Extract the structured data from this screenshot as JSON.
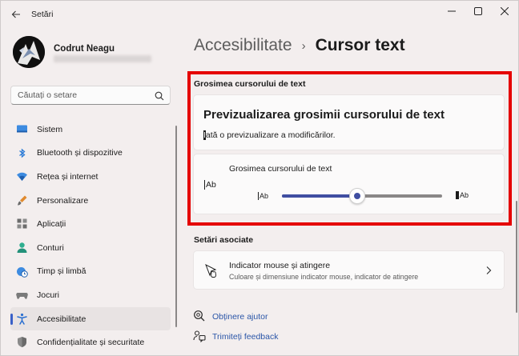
{
  "window": {
    "title": "Setări"
  },
  "user": {
    "name": "Codrut Neagu"
  },
  "search": {
    "placeholder": "Căutați o setare"
  },
  "nav": [
    {
      "label": "Sistem",
      "icon": "monitor-icon"
    },
    {
      "label": "Bluetooth și dispozitive",
      "icon": "bluetooth-icon"
    },
    {
      "label": "Rețea și internet",
      "icon": "wifi-icon"
    },
    {
      "label": "Personalizare",
      "icon": "brush-icon"
    },
    {
      "label": "Aplicații",
      "icon": "apps-icon"
    },
    {
      "label": "Conturi",
      "icon": "person-icon"
    },
    {
      "label": "Timp și limbă",
      "icon": "globe-clock-icon"
    },
    {
      "label": "Jocuri",
      "icon": "gamepad-icon"
    },
    {
      "label": "Accesibilitate",
      "icon": "accessibility-icon",
      "selected": true
    },
    {
      "label": "Confidențialitate și securitate",
      "icon": "shield-icon"
    }
  ],
  "breadcrumb": {
    "parent": "Accesibilitate",
    "separator": "›",
    "current": "Cursor text"
  },
  "thickness_section": {
    "label": "Grosimea cursorului de text",
    "preview_title": "Previzualizarea grosimii cursorului de text",
    "preview_caret_char": "I",
    "preview_text_rest": "ată o previzualizare a modificărilor.",
    "setting_label": "Grosimea cursorului de text",
    "sample_text": "Ab",
    "slider_value_fraction": 0.47
  },
  "related_section": {
    "label": "Setări asociate",
    "item_title": "Indicator mouse și atingere",
    "item_desc": "Culoare și dimensiune indicator mouse, indicator de atingere"
  },
  "links": {
    "help": "Obținere ajutor",
    "feedback": "Trimiteți feedback"
  },
  "colors": {
    "accent": "#3f4ea1",
    "highlight": "#e50000",
    "link": "#2b56a8"
  }
}
